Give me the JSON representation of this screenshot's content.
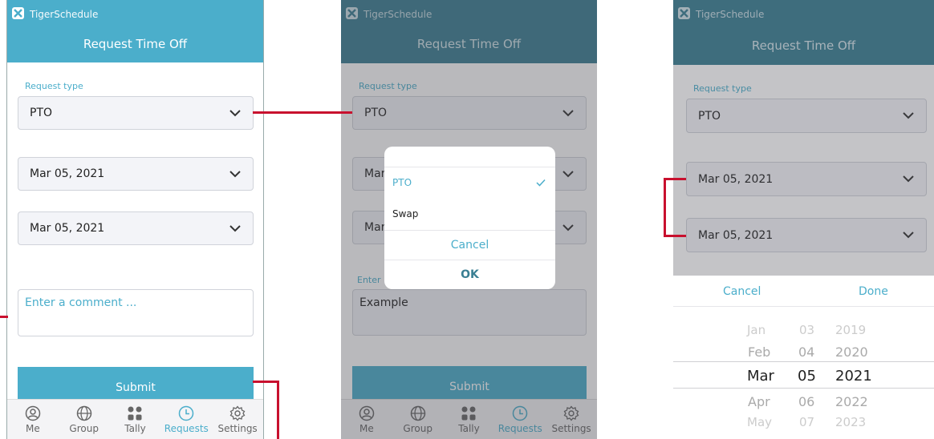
{
  "app": {
    "name": "TigerSchedule",
    "title": "Request Time Off"
  },
  "form": {
    "request_type_label": "Request type",
    "request_type_value": "PTO",
    "start_date": "Mar 05, 2021",
    "end_date": "Mar 05, 2021",
    "comment_placeholder": "Enter a comment ...",
    "comment_value": "Example",
    "comment_label_partial": "Enter",
    "start_date_partial": "Mar",
    "end_date_partial": "Mar",
    "submit_label": "Submit"
  },
  "tabs": [
    {
      "label": "Me",
      "icon": "person-icon"
    },
    {
      "label": "Group",
      "icon": "globe-icon"
    },
    {
      "label": "Tally",
      "icon": "grid-icon"
    },
    {
      "label": "Requests",
      "icon": "clock-icon",
      "active": true
    },
    {
      "label": "Settings",
      "icon": "gear-icon"
    }
  ],
  "type_dialog": {
    "options": [
      {
        "label": "PTO",
        "selected": true
      },
      {
        "label": "Swap",
        "selected": false
      }
    ],
    "cancel_label": "Cancel",
    "ok_label": "OK"
  },
  "date_picker": {
    "cancel_label": "Cancel",
    "done_label": "Done",
    "months": [
      "Jan",
      "Feb",
      "Mar",
      "Apr",
      "May"
    ],
    "days": [
      "03",
      "04",
      "05",
      "06",
      "07"
    ],
    "years": [
      "2019",
      "2020",
      "2021",
      "2022",
      "2023"
    ],
    "selected": {
      "month": "Mar",
      "day": "05",
      "year": "2021"
    }
  },
  "colors": {
    "primary": "#4baecb",
    "primary_dark": "#3a7f93",
    "connector": "#c8102e"
  }
}
